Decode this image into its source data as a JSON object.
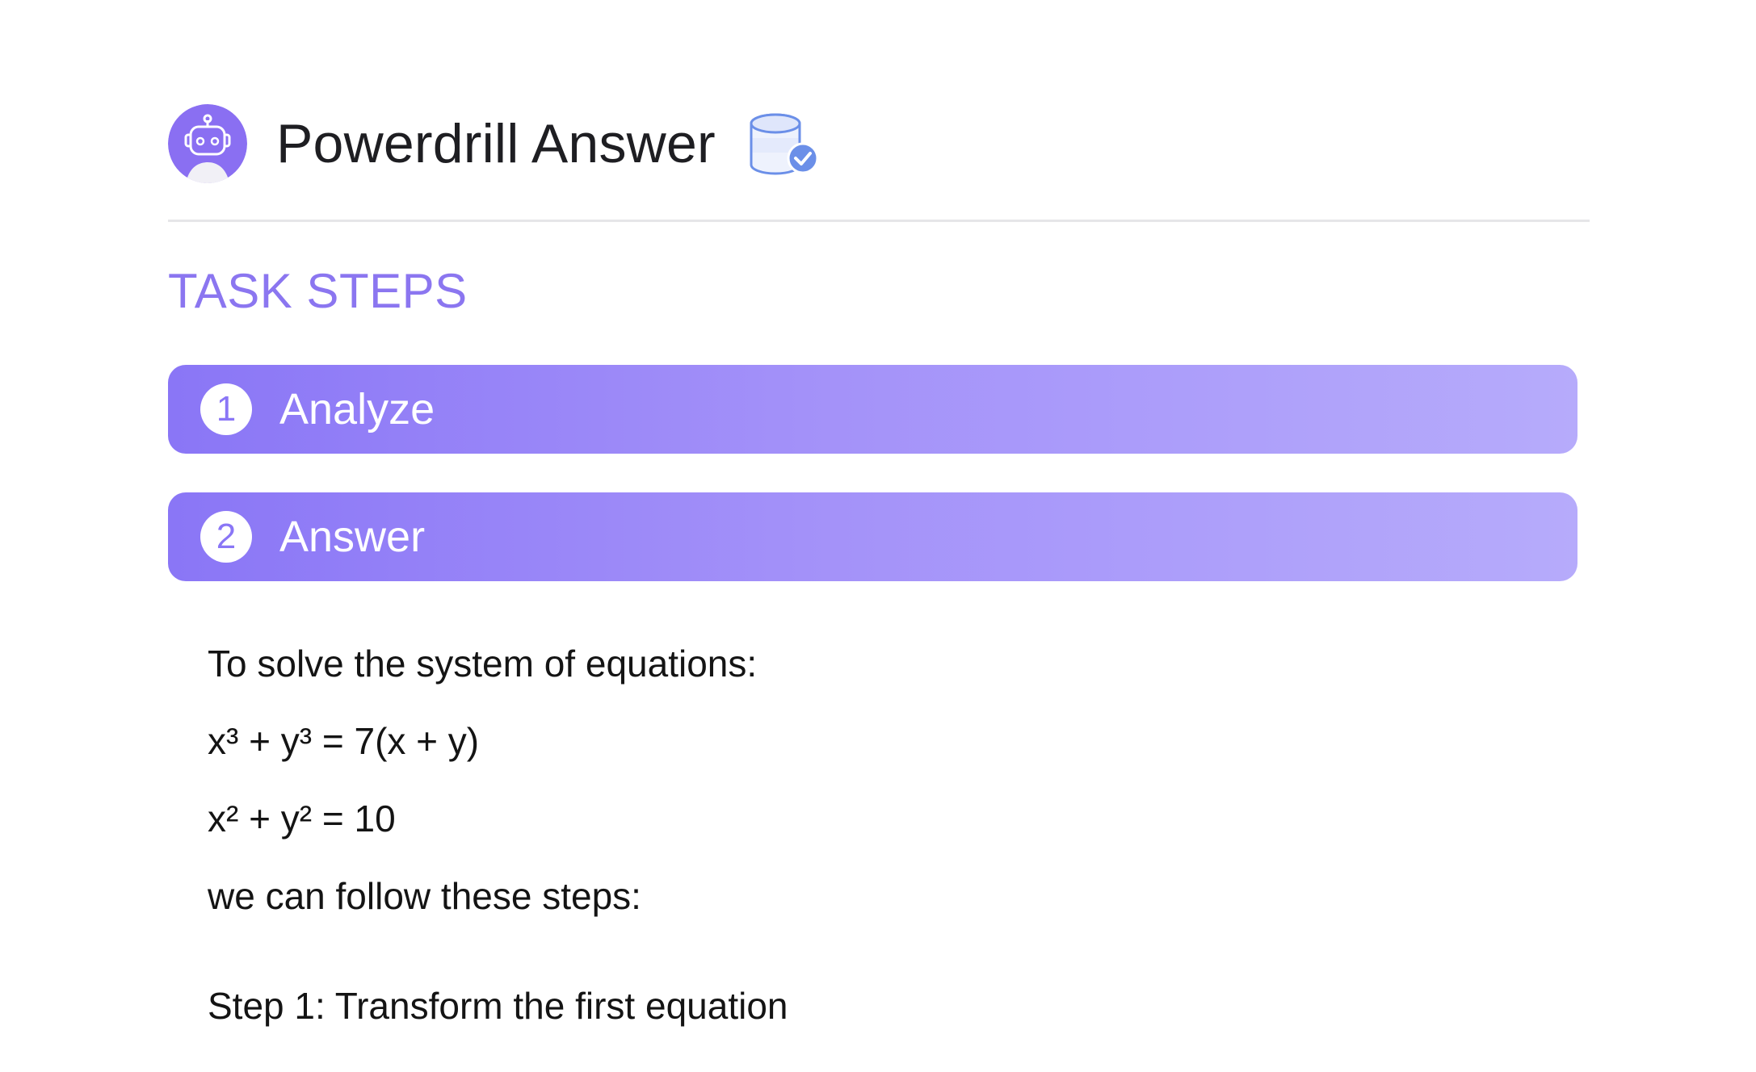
{
  "header": {
    "title": "Powerdrill Answer",
    "avatar_icon": "robot-avatar-icon",
    "datasource_icon": "database-check-icon"
  },
  "task_steps": {
    "heading": "TASK STEPS",
    "steps": [
      {
        "number": "1",
        "label": "Analyze"
      },
      {
        "number": "2",
        "label": "Answer"
      }
    ]
  },
  "answer": {
    "lines": [
      "To solve the system of equations:",
      "x³ + y³ = 7(x + y)",
      "x² + y² = 10",
      "we can follow these steps:",
      "Step 1: Transform the first equation"
    ]
  },
  "colors": {
    "accent": "#8b76f0",
    "step_gradient_start": "#8a76f6",
    "step_gradient_end": "#b6abfb",
    "avatar_bg": "#8a6ff2",
    "database_blue": "#6b8fe8"
  }
}
